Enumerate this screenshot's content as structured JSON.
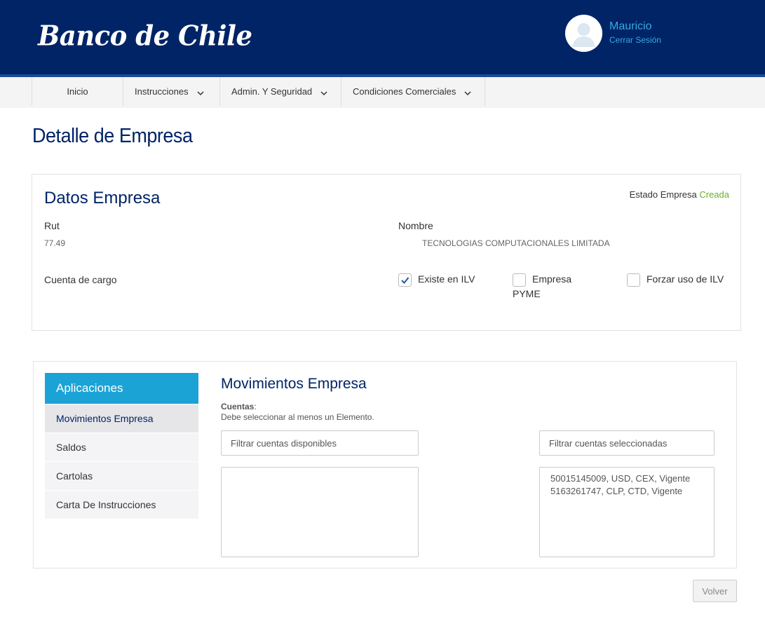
{
  "header": {
    "logo_text": "Banco de Chile",
    "user_name": "Mauricio",
    "logout_label": "Cerrar Sesión",
    "bg_color": "#002466"
  },
  "nav": {
    "items": [
      {
        "label": "Inicio",
        "has_dropdown": false
      },
      {
        "label": "Instrucciones",
        "has_dropdown": true
      },
      {
        "label": "Admin. Y Seguridad",
        "has_dropdown": true
      },
      {
        "label": "Condiciones Comerciales",
        "has_dropdown": true
      }
    ]
  },
  "page": {
    "title": "Detalle de Empresa"
  },
  "empresa": {
    "title": "Datos Empresa",
    "estado_label": "Estado Empresa",
    "estado_value": "Creada",
    "estado_color": "#6ab023",
    "rut_label": "Rut",
    "rut_value": "77.49",
    "nombre_label": "Nombre",
    "nombre_value": "TECNOLOGIAS COMPUTACIONALES LIMITADA",
    "cuenta_cargo_label": "Cuenta de cargo",
    "checkboxes": [
      {
        "label": "Existe en ILV",
        "checked": true
      },
      {
        "label": "Empresa PYME",
        "checked": false
      },
      {
        "label": "Forzar uso de ILV",
        "checked": false
      }
    ]
  },
  "aplicaciones": {
    "header": "Aplicaciones",
    "accent_color": "#1ba3d6",
    "items": [
      {
        "label": "Movimientos Empresa",
        "active": true
      },
      {
        "label": "Saldos",
        "active": false
      },
      {
        "label": "Cartolas",
        "active": false
      },
      {
        "label": "Carta De Instrucciones",
        "active": false
      }
    ]
  },
  "movimientos": {
    "title": "Movimientos Empresa",
    "cuentas_label": "Cuentas",
    "cuentas_hint": "Debe seleccionar al menos un Elemento.",
    "filter_available_placeholder": "Filtrar cuentas disponibles",
    "filter_selected_placeholder": "Filtrar cuentas seleccionadas",
    "available_accounts": [],
    "selected_accounts": [
      "50015145009, USD, CEX, Vigente",
      "5163261747, CLP, CTD, Vigente"
    ]
  },
  "actions": {
    "volver_label": "Volver"
  }
}
